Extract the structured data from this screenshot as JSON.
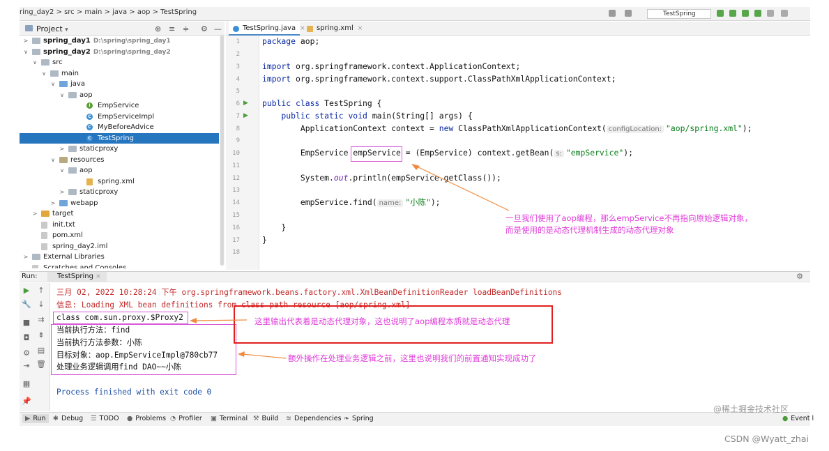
{
  "breadcrumb": "ring_day2 > src > main > java > aop > TestSpring",
  "run_config": "TestSpring",
  "project_panel": {
    "title": "Project",
    "dropdown": "▾"
  },
  "tree": [
    {
      "label": "spring_day1",
      "path": "D:\\spring\\spring_day1",
      "indent": 0,
      "arrow": ">",
      "icon": "module-folder",
      "bold": true
    },
    {
      "label": "spring_day2",
      "path": "D:\\spring\\spring_day2",
      "indent": 0,
      "arrow": "∨",
      "icon": "module-folder",
      "bold": true
    },
    {
      "label": "src",
      "indent": 1,
      "arrow": "∨",
      "icon": "folder"
    },
    {
      "label": "main",
      "indent": 2,
      "arrow": "∨",
      "icon": "folder"
    },
    {
      "label": "java",
      "indent": 3,
      "arrow": "∨",
      "icon": "source-folder"
    },
    {
      "label": "aop",
      "indent": 4,
      "arrow": "∨",
      "icon": "package"
    },
    {
      "label": "EmpService",
      "indent": 6,
      "arrow": "",
      "icon": "interface"
    },
    {
      "label": "EmpServiceImpl",
      "indent": 6,
      "arrow": "",
      "icon": "class"
    },
    {
      "label": "MyBeforeAdvice",
      "indent": 6,
      "arrow": "",
      "icon": "class"
    },
    {
      "label": "TestSpring",
      "indent": 6,
      "arrow": "",
      "icon": "class",
      "selected": true
    },
    {
      "label": "staticproxy",
      "indent": 4,
      "arrow": ">",
      "icon": "package"
    },
    {
      "label": "resources",
      "indent": 3,
      "arrow": "∨",
      "icon": "resources-folder"
    },
    {
      "label": "aop",
      "indent": 4,
      "arrow": "∨",
      "icon": "folder"
    },
    {
      "label": "spring.xml",
      "indent": 6,
      "arrow": "",
      "icon": "xml-file"
    },
    {
      "label": "staticproxy",
      "indent": 4,
      "arrow": ">",
      "icon": "folder"
    },
    {
      "label": "webapp",
      "indent": 3,
      "arrow": ">",
      "icon": "web-folder"
    },
    {
      "label": "target",
      "indent": 1,
      "arrow": ">",
      "icon": "excluded-folder"
    },
    {
      "label": "init.txt",
      "indent": 1,
      "arrow": "",
      "icon": "text-file"
    },
    {
      "label": "pom.xml",
      "indent": 1,
      "arrow": "",
      "icon": "maven-file"
    },
    {
      "label": "spring_day2.iml",
      "indent": 1,
      "arrow": "",
      "icon": "iml-file"
    },
    {
      "label": "External Libraries",
      "indent": 0,
      "arrow": ">",
      "icon": "library"
    },
    {
      "label": "Scratches and Consoles",
      "indent": 0,
      "arrow": "",
      "icon": "scratch"
    }
  ],
  "tabs": [
    {
      "label": "TestSpring.java",
      "active": true
    },
    {
      "label": "spring.xml",
      "active": false
    }
  ],
  "code": {
    "l1_kw": "package",
    "l1_rest": " aop;",
    "l3_kw": "import",
    "l3_rest": " org.springframework.context.ApplicationContext;",
    "l4_kw": "import",
    "l4_rest": " org.springframework.context.support.ClassPathXmlApplicationContext;",
    "l6_kw": "public class",
    "l6_rest": " TestSpring {",
    "l7_kw": "    public static void",
    "l7_rest": " main(String[] args) {",
    "l8_a": "        ApplicationContext context = ",
    "l8_kw": "new",
    "l8_b": " ClassPathXmlApplicationContext(",
    "l8_hint": "configLocation:",
    "l8_str": "\"aop/spring.xml\"",
    "l8_c": ");",
    "l10_a": "        EmpService empService = (EmpService) context.getBean(",
    "l10_hint": "s:",
    "l10_str": "\"empService\"",
    "l10_c": ");",
    "l12_a": "        System.",
    "l12_it": "out",
    "l12_b": ".println(empService.getClass());",
    "l14_a": "        empService.find(",
    "l14_hint": "name:",
    "l14_str": "\"小陈\"",
    "l14_c": ");",
    "l16": "    }",
    "l17": "}"
  },
  "line_numbers": [
    "1",
    "2",
    "3",
    "4",
    "5",
    "6",
    "7",
    "8",
    "9",
    "10",
    "11",
    "12",
    "13",
    "14",
    "15",
    "16",
    "17",
    "18"
  ],
  "annotation_code": [
    "一旦我们使用了aop编程，那么empService不再指向原始逻辑对象，",
    "而是使用的是动态代理机制生成的动态代理对象"
  ],
  "run_panel": {
    "label": "Run:",
    "tab": "TestSpring"
  },
  "console": {
    "line1": "三月 02, 2022 10:28:24 下午 org.springframework.beans.factory.xml.XmlBeanDefinitionReader loadBeanDefinitions",
    "line2": "信息: Loading XML bean definitions from class path resource [aop/spring.xml]",
    "line3": "class com.sun.proxy.$Proxy2",
    "line4": "当前执行方法：find",
    "line5": "当前执行方法参数：小陈",
    "line6": "目标对象：aop.EmpServiceImpl@780cb77",
    "line7": "处理业务逻辑调用find DAO~~小陈",
    "line8": "Process finished with exit code 0"
  },
  "annotation_proxy": "这里输出代表着是动态代理对象，这也说明了aop编程本质就是动态代理",
  "annotation_advice": "额外操作在处理业务逻辑之前，这里也说明我们的前置通知实现成功了",
  "bottom_tools": [
    "Run",
    "Debug",
    "TODO",
    "Problems",
    "Profiler",
    "Terminal",
    "Build",
    "Dependencies",
    "Spring"
  ],
  "event_log": "Event l",
  "watermark1": "@稀土掘金技术社区",
  "watermark2": "CSDN @Wyatt_zhai",
  "colors": {
    "accent": "#2675bf",
    "annotation": "#e03ad9",
    "highlight_box": "#e11f1f"
  }
}
